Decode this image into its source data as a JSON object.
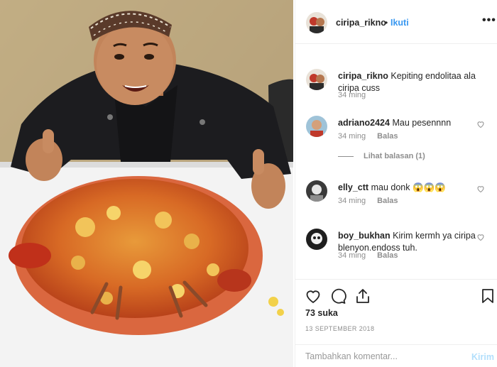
{
  "header": {
    "username": "ciripa_rikno",
    "separator": "•",
    "follow_label": "Ikuti",
    "more_icon": "more-options-icon"
  },
  "caption": {
    "username": "ciripa_rikno",
    "text": "Kepiting endolitaa ala ciripa cuss",
    "time": "34 ming"
  },
  "comments": [
    {
      "username": "adriano2424",
      "text": "Mau pesennnn",
      "time": "34 ming",
      "reply_label": "Balas"
    },
    {
      "username": "elly_ctt",
      "text": "mau donk 😱😱😱",
      "time": "34 ming",
      "reply_label": "Balas"
    },
    {
      "username": "boy_bukhan",
      "text": "Kirim kermh ya ciripa blenyon.endoss tuh.",
      "time": "34 ming",
      "reply_label": "Balas"
    }
  ],
  "view_replies": "Lihat balasan (1)",
  "actions": {
    "icons": [
      "heart-icon",
      "comment-icon",
      "share-icon",
      "bookmark-icon"
    ],
    "likes": "73 suka",
    "date": "13 SEPTEMBER 2018"
  },
  "add_comment": {
    "placeholder": "Tambahkan komentar...",
    "post_label": "Kirim"
  },
  "colors": {
    "link_blue": "#3897f0",
    "muted": "#8e8e8e",
    "post_disabled": "#b2dffc",
    "text": "#262626"
  }
}
